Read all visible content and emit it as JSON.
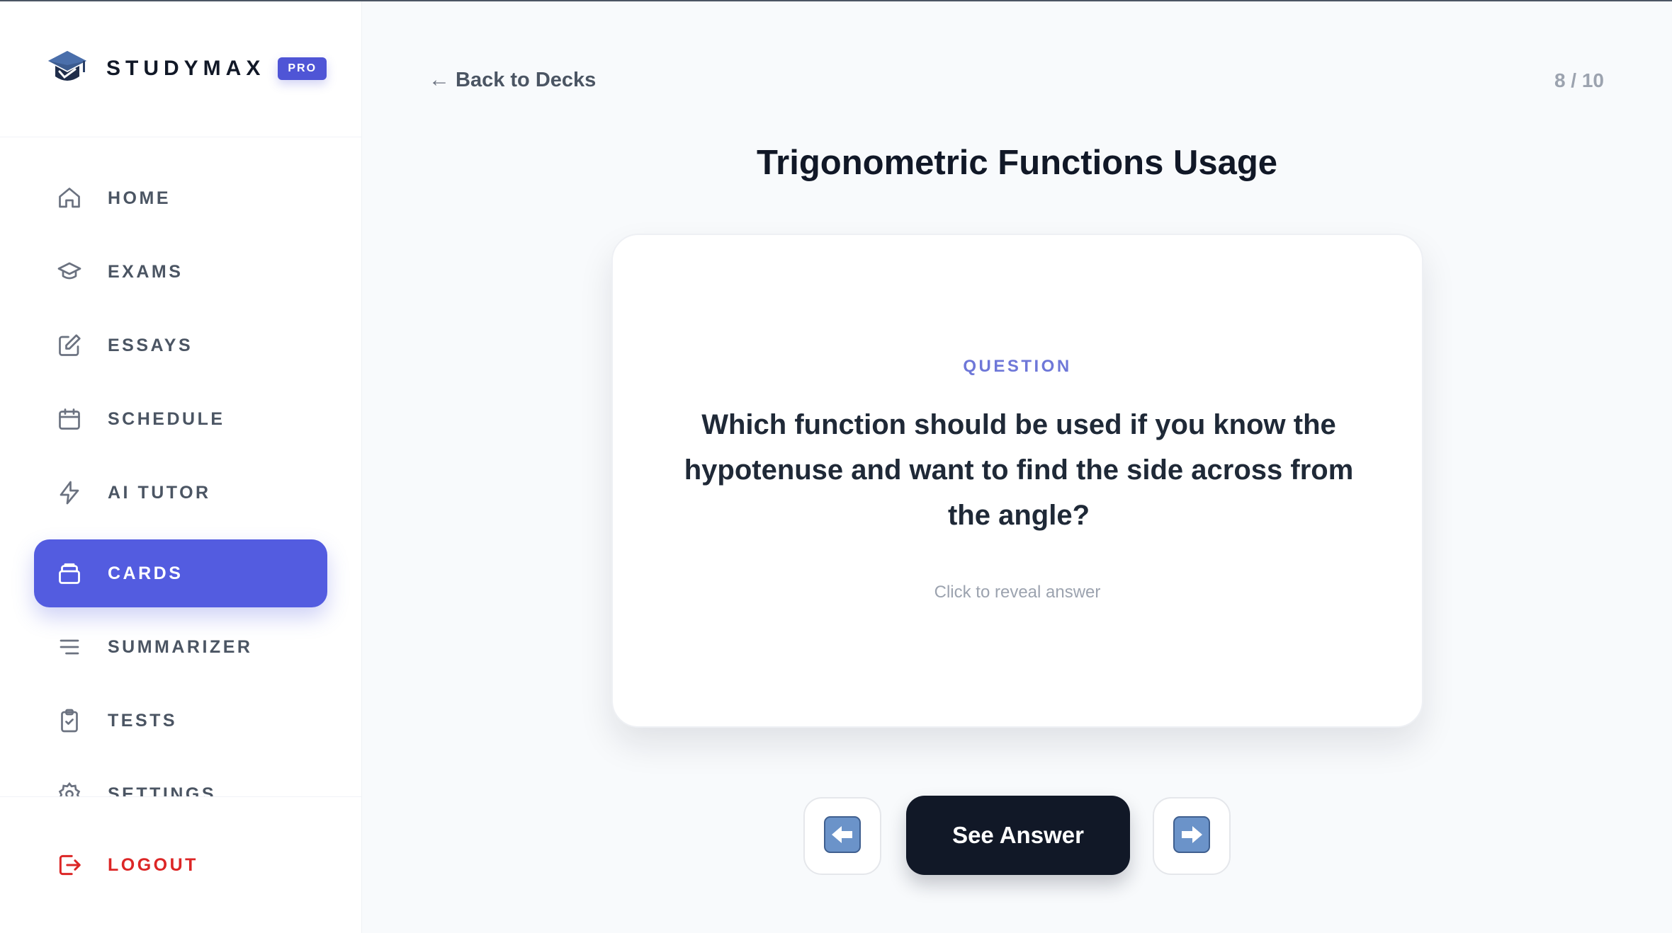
{
  "brand": {
    "name": "STUDYMAX",
    "badge": "PRO"
  },
  "nav": {
    "items": [
      {
        "label": "HOME",
        "icon": "home-icon"
      },
      {
        "label": "EXAMS",
        "icon": "graduation-cap-icon"
      },
      {
        "label": "ESSAYS",
        "icon": "pencil-square-icon"
      },
      {
        "label": "SCHEDULE",
        "icon": "calendar-icon"
      },
      {
        "label": "AI TUTOR",
        "icon": "lightning-icon"
      },
      {
        "label": "CARDS",
        "icon": "cards-stack-icon",
        "active": true
      },
      {
        "label": "SUMMARIZER",
        "icon": "lines-icon"
      },
      {
        "label": "TESTS",
        "icon": "clipboard-check-icon"
      },
      {
        "label": "SETTINGS",
        "icon": "gear-icon"
      }
    ],
    "logout": {
      "label": "LOGOUT",
      "icon": "logout-icon"
    }
  },
  "main": {
    "back_label": "Back to Decks",
    "counter": "8 / 10",
    "deck_title": "Trigonometric Functions Usage"
  },
  "card": {
    "kicker": "QUESTION",
    "question": "Which function should be used if you know the hypotenuse and want to find the side across from the angle?",
    "hint": "Click to reveal answer"
  },
  "controls": {
    "see_answer": "See Answer",
    "prev_icon": "left-arrow-icon",
    "next_icon": "right-arrow-icon"
  },
  "colors": {
    "accent": "#535ce0",
    "dark_button": "#111827",
    "logout": "#dc2626",
    "kicker": "#6e77d8"
  }
}
